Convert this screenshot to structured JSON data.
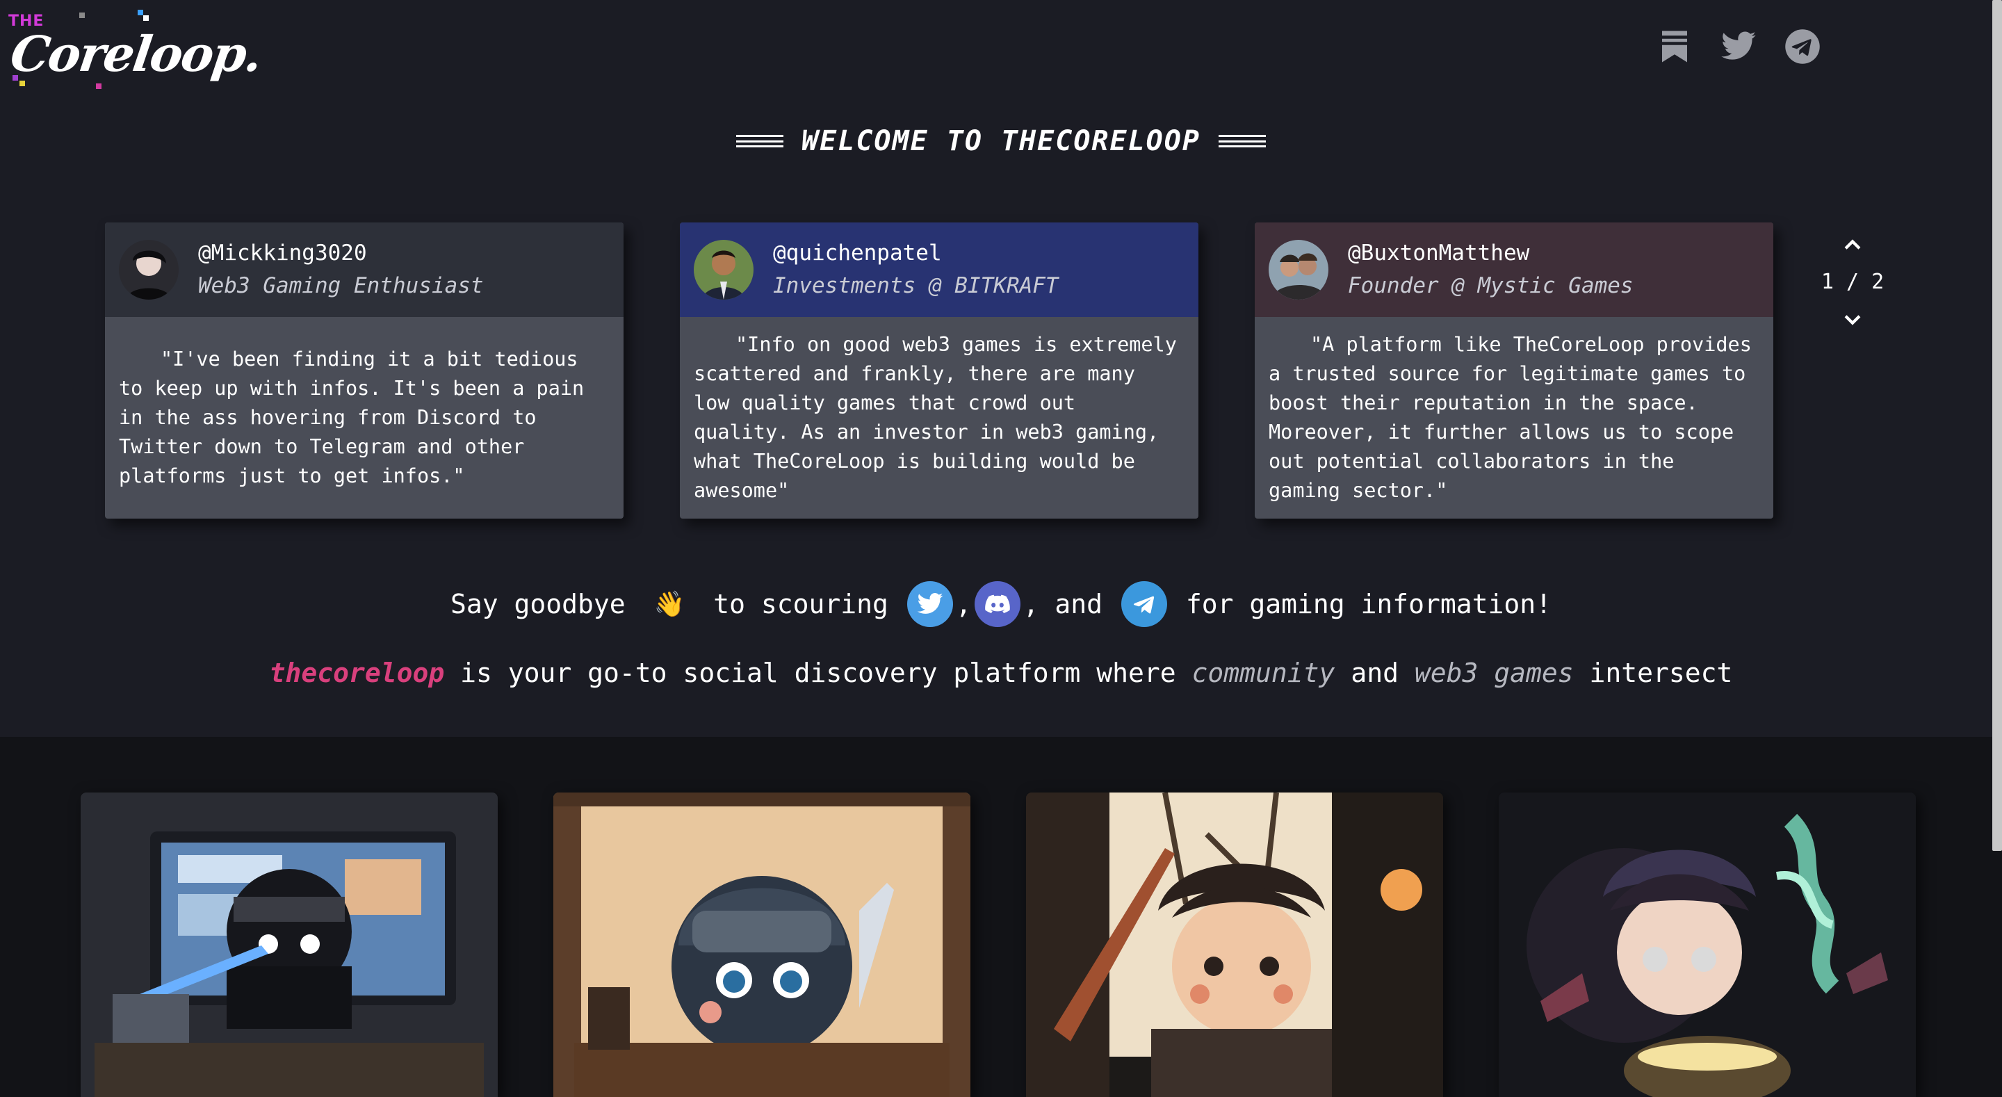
{
  "logo": {
    "prefix": "THE",
    "word": "Coreloop."
  },
  "header_icons": [
    {
      "name": "bookmark-icon"
    },
    {
      "name": "twitter-icon"
    },
    {
      "name": "telegram-icon"
    }
  ],
  "welcome": {
    "title": "WELCOME TO THECORELOOP"
  },
  "testimonials": [
    {
      "handle": "@Mickking3020",
      "role": "Web3 Gaming Enthusiast",
      "quote": "\"I've been finding it a bit tedious to keep up with infos. It's been a pain in the ass hovering from Discord to Twitter down to Telegram and other platforms just to get infos.\"",
      "header_color": "#2d3039"
    },
    {
      "handle": "@quichenpatel",
      "role": "Investments @ BITKRAFT",
      "quote": "\"Info on good web3 games is extremely scattered and frankly, there are many low quality games that crowd out quality. As an investor in web3 gaming, what TheCoreLoop is building would be awesome\"",
      "header_color": "#283372"
    },
    {
      "handle": "@BuxtonMatthew",
      "role": "Founder @ Mystic Games",
      "quote": "\"A platform like TheCoreLoop provides a trusted source for legitimate games to boost their reputation in the space. Moreover, it further allows us to scope out potential collaborators in the gaming sector.\"",
      "header_color": "#3f2f39"
    }
  ],
  "pager": {
    "current": "1",
    "separator": "/",
    "total": "2"
  },
  "tagline": {
    "part1": "Say goodbye ",
    "wave": "👋",
    "part2": " to scouring ",
    "comma1": ",",
    "and": ", and ",
    "part3": " for gaming information!"
  },
  "subline": {
    "brand": "thecoreloop",
    "middle": " is your go-to social discovery platform where ",
    "community": "community",
    "and": " and ",
    "web3": "web3 games",
    "end": " intersect"
  },
  "colors": {
    "background": "#1b1c24",
    "brand_pink": "#d9407d",
    "twitter_blue": "#4a9ee6",
    "discord_purple": "#5865c9",
    "telegram_blue": "#3b98dd"
  }
}
